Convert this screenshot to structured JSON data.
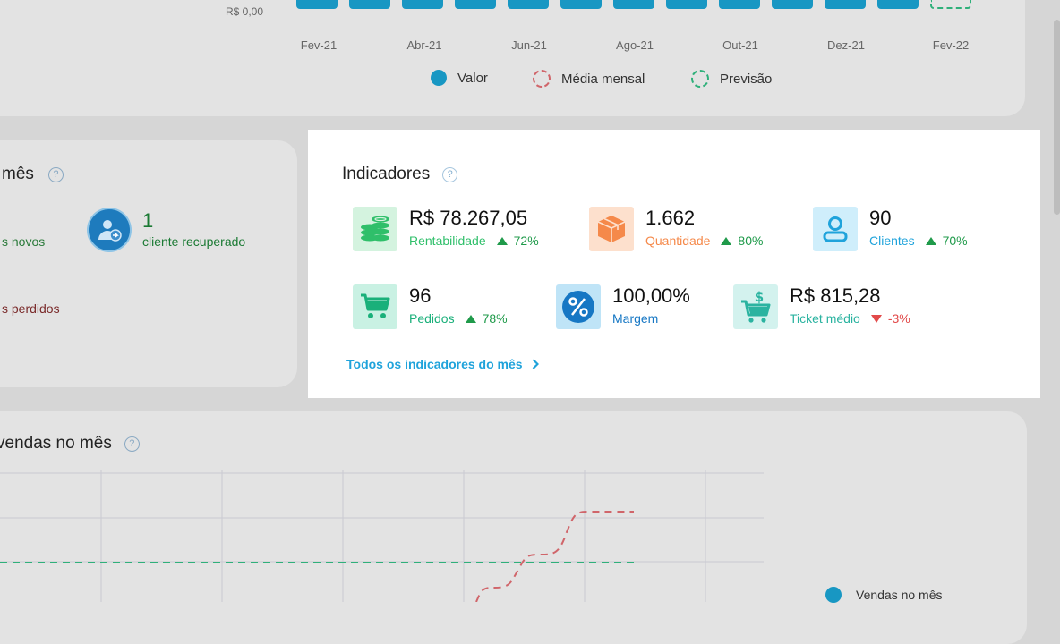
{
  "top_chart": {
    "y_tick": "R$ 0,00",
    "x_ticks": [
      "Fev-21",
      "Abr-21",
      "Jun-21",
      "Ago-21",
      "Out-21",
      "Dez-21",
      "Fev-22"
    ],
    "legend": [
      {
        "label": "Valor",
        "color": "#1897c3"
      },
      {
        "label": "Média mensal",
        "color": "#d0656a"
      },
      {
        "label": "Previsão",
        "color": "#2fb07a"
      }
    ]
  },
  "clientes_card": {
    "title": "mês",
    "novos_label": "s novos",
    "recuperado_value": "1",
    "recuperado_label": "cliente recuperado",
    "perdidos_label": "s perdidos"
  },
  "indicadores": {
    "title": "Indicadores",
    "help": "?",
    "metrics": [
      {
        "value": "R$ 78.267,05",
        "label": "Rentabilidade",
        "change": "72%",
        "trend": "up",
        "icon": "coins-icon",
        "color": "#2fbf6a"
      },
      {
        "value": "1.662",
        "label": "Quantidade",
        "change": "80%",
        "trend": "up",
        "icon": "box-icon",
        "color": "#f5894a"
      },
      {
        "value": "90",
        "label": "Clientes",
        "change": "70%",
        "trend": "up",
        "icon": "user-icon",
        "color": "#1fa3db"
      },
      {
        "value": "96",
        "label": "Pedidos",
        "change": "78%",
        "trend": "up",
        "icon": "cart-icon",
        "color": "#1ab07a"
      },
      {
        "value": "100,00%",
        "label": "Margem",
        "change": "",
        "trend": "none",
        "icon": "percent-icon",
        "color": "#1677c4"
      },
      {
        "value": "R$ 815,28",
        "label": "Ticket médio",
        "change": "-3%",
        "trend": "down",
        "icon": "cart-dollar-icon",
        "color": "#2ab3a0"
      }
    ],
    "link": "Todos os indicadores do mês"
  },
  "vendas_card": {
    "title": "vendas no mês",
    "legend_label": "Vendas no mês"
  }
}
